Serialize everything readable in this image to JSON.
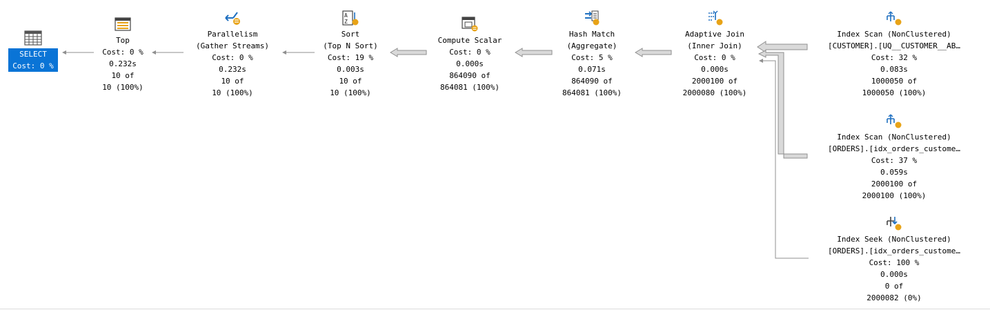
{
  "plan": {
    "select": {
      "name": "SELECT",
      "cost": "Cost: 0 %",
      "icon": "select-result-icon"
    },
    "top": {
      "name": "Top",
      "cost": "Cost: 0 %",
      "time": "0.232s",
      "rows_a": "10 of",
      "rows_b": "10 (100%)",
      "icon": "top-operator-icon"
    },
    "parallelism": {
      "name": "Parallelism",
      "sub": "(Gather Streams)",
      "cost": "Cost: 0 %",
      "time": "0.232s",
      "rows_a": "10 of",
      "rows_b": "10 (100%)",
      "icon": "parallelism-icon"
    },
    "sort": {
      "name": "Sort",
      "sub": "(Top N Sort)",
      "cost": "Cost: 19 %",
      "time": "0.003s",
      "rows_a": "10 of",
      "rows_b": "10 (100%)",
      "icon": "sort-icon"
    },
    "compute_scalar": {
      "name": "Compute Scalar",
      "cost": "Cost: 0 %",
      "time": "0.000s",
      "rows_a": "864090 of",
      "rows_b": "864081 (100%)",
      "icon": "compute-scalar-icon"
    },
    "hash_match": {
      "name": "Hash Match",
      "sub": "(Aggregate)",
      "cost": "Cost: 5 %",
      "time": "0.071s",
      "rows_a": "864090 of",
      "rows_b": "864081 (100%)",
      "icon": "hash-match-icon"
    },
    "adaptive_join": {
      "name": "Adaptive Join",
      "sub": "(Inner Join)",
      "cost": "Cost: 0 %",
      "time": "0.000s",
      "rows_a": "2000100 of",
      "rows_b": "2000080 (100%)",
      "icon": "adaptive-join-icon"
    },
    "index_scan_customer": {
      "name": "Index Scan (NonClustered)",
      "sub": "[CUSTOMER].[UQ__CUSTOMER__AB…",
      "cost": "Cost: 32 %",
      "time": "0.083s",
      "rows_a": "1000050 of",
      "rows_b": "1000050 (100%)",
      "icon": "index-scan-icon"
    },
    "index_scan_orders": {
      "name": "Index Scan (NonClustered)",
      "sub": "[ORDERS].[idx_orders_custome…",
      "cost": "Cost: 37 %",
      "time": "0.059s",
      "rows_a": "2000100 of",
      "rows_b": "2000100 (100%)",
      "icon": "index-scan-icon"
    },
    "index_seek_orders": {
      "name": "Index Seek (NonClustered)",
      "sub": "[ORDERS].[idx_orders_custome…",
      "cost": "Cost: 100 %",
      "time": "0.000s",
      "rows_a": "0 of",
      "rows_b": "2000082 (0%)",
      "icon": "index-seek-icon"
    }
  },
  "colors": {
    "selection": "#0a74d6",
    "icon_blue": "#1e6fc0",
    "icon_gold": "#e8a317",
    "arrow_fill": "#d9d9d9",
    "arrow_stroke": "#8f8f8f"
  }
}
